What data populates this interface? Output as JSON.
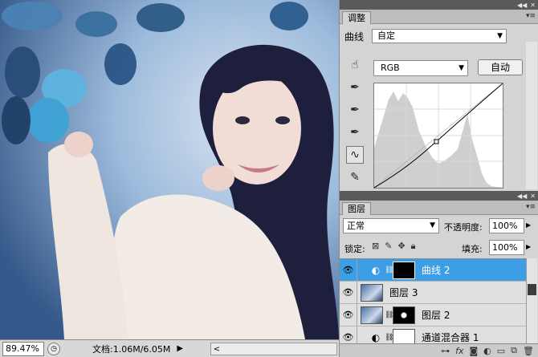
{
  "canvas": {
    "zoom": "89.47%",
    "doc_info": "文档:1.06M/6.05M"
  },
  "adjustments": {
    "tab_label": "调整",
    "preset_label": "曲线",
    "preset_value": "自定",
    "channel": "RGB",
    "auto_label": "自动",
    "tools": [
      "hand-adjust-icon",
      "black-eyedropper-icon",
      "gray-eyedropper-icon",
      "white-eyedropper-icon",
      "curve-tool-icon",
      "pencil-icon"
    ]
  },
  "layers": {
    "tab_label": "图层",
    "blend_mode": "正常",
    "opacity_label": "不透明度:",
    "opacity_value": "100%",
    "lock_label": "锁定:",
    "fill_label": "填充:",
    "fill_value": "100%",
    "rows": [
      {
        "name": "曲线 2",
        "selected": true
      },
      {
        "name": "图层 3",
        "selected": false
      },
      {
        "name": "图层 2",
        "selected": false
      },
      {
        "name": "通道混合器 1",
        "selected": false
      }
    ],
    "bottom_icons": [
      "link-icon",
      "fx-icon",
      "mask-icon",
      "adjustment-icon",
      "group-icon",
      "new-layer-icon",
      "trash-icon"
    ]
  },
  "colors": {
    "selection": "#3d9ee6",
    "panel_bg": "#d4d4d4"
  }
}
